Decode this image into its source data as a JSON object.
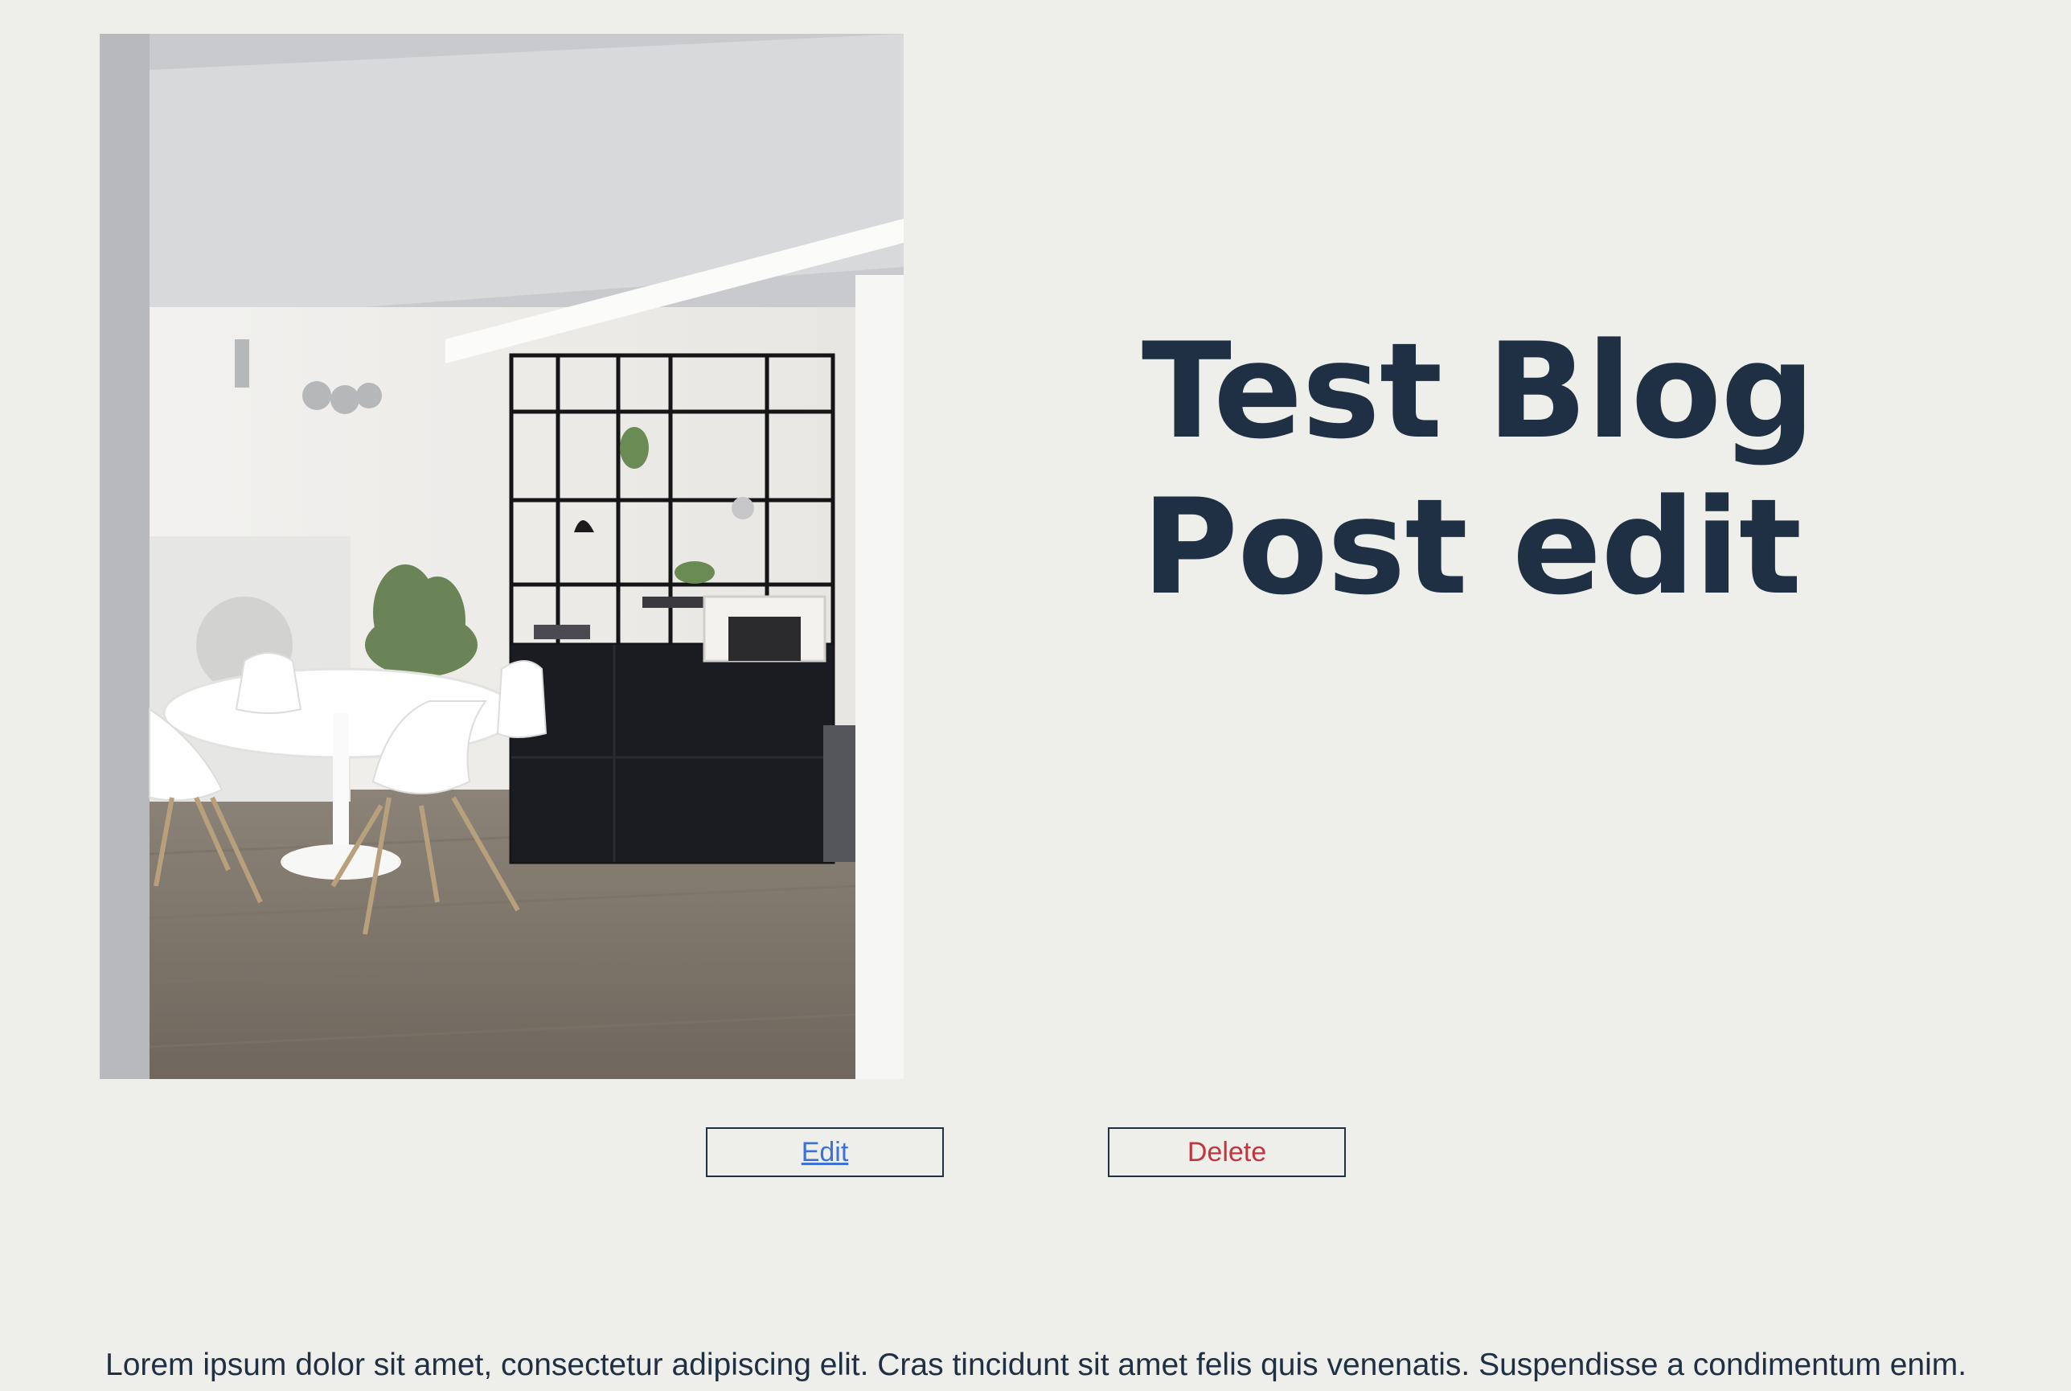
{
  "post": {
    "title": "Test Blog Post edit",
    "body": "Lorem ipsum dolor sit amet, consectetur adipiscing elit. Cras tincidunt sit amet felis quis venenatis. Suspendisse a condimentum enim."
  },
  "actions": {
    "edit_label": "Edit",
    "delete_label": "Delete"
  },
  "colors": {
    "page_background": "#eeeeea",
    "heading": "#1f3044",
    "edit_link": "#3c72d6",
    "delete_text": "#c1363e",
    "button_border": "#1f3044"
  }
}
